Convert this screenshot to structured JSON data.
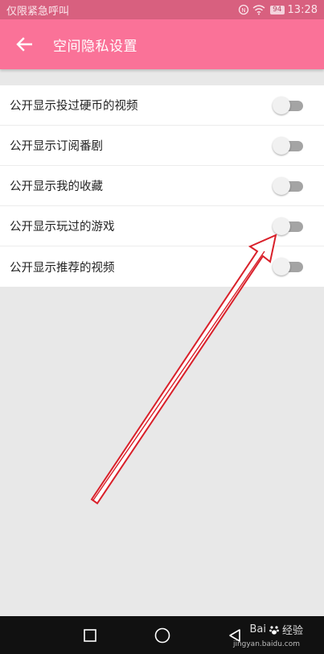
{
  "status_bar": {
    "left_text": "仅限紧急呼叫",
    "battery": "94",
    "time": "13:28"
  },
  "app_bar": {
    "title": "空间隐私设置",
    "back_icon": "arrow-left-icon"
  },
  "settings": [
    {
      "label": "公开显示投过硬币的视频",
      "enabled": false
    },
    {
      "label": "公开显示订阅番剧",
      "enabled": false
    },
    {
      "label": "公开显示我的收藏",
      "enabled": false
    },
    {
      "label": "公开显示玩过的游戏",
      "enabled": false
    },
    {
      "label": "公开显示推荐的视频",
      "enabled": false
    }
  ],
  "nav_bar": {
    "recents_icon": "square-icon",
    "home_icon": "circle-icon",
    "back_icon": "triangle-back-icon"
  },
  "watermark": {
    "brand": "Bai",
    "suffix": "经验",
    "url": "jingyan.baidu.com"
  },
  "colors": {
    "status_bar": "#d8607f",
    "app_bar": "#fa7298",
    "background": "#e8e8e8",
    "annotation_arrow": "#d9202a"
  }
}
